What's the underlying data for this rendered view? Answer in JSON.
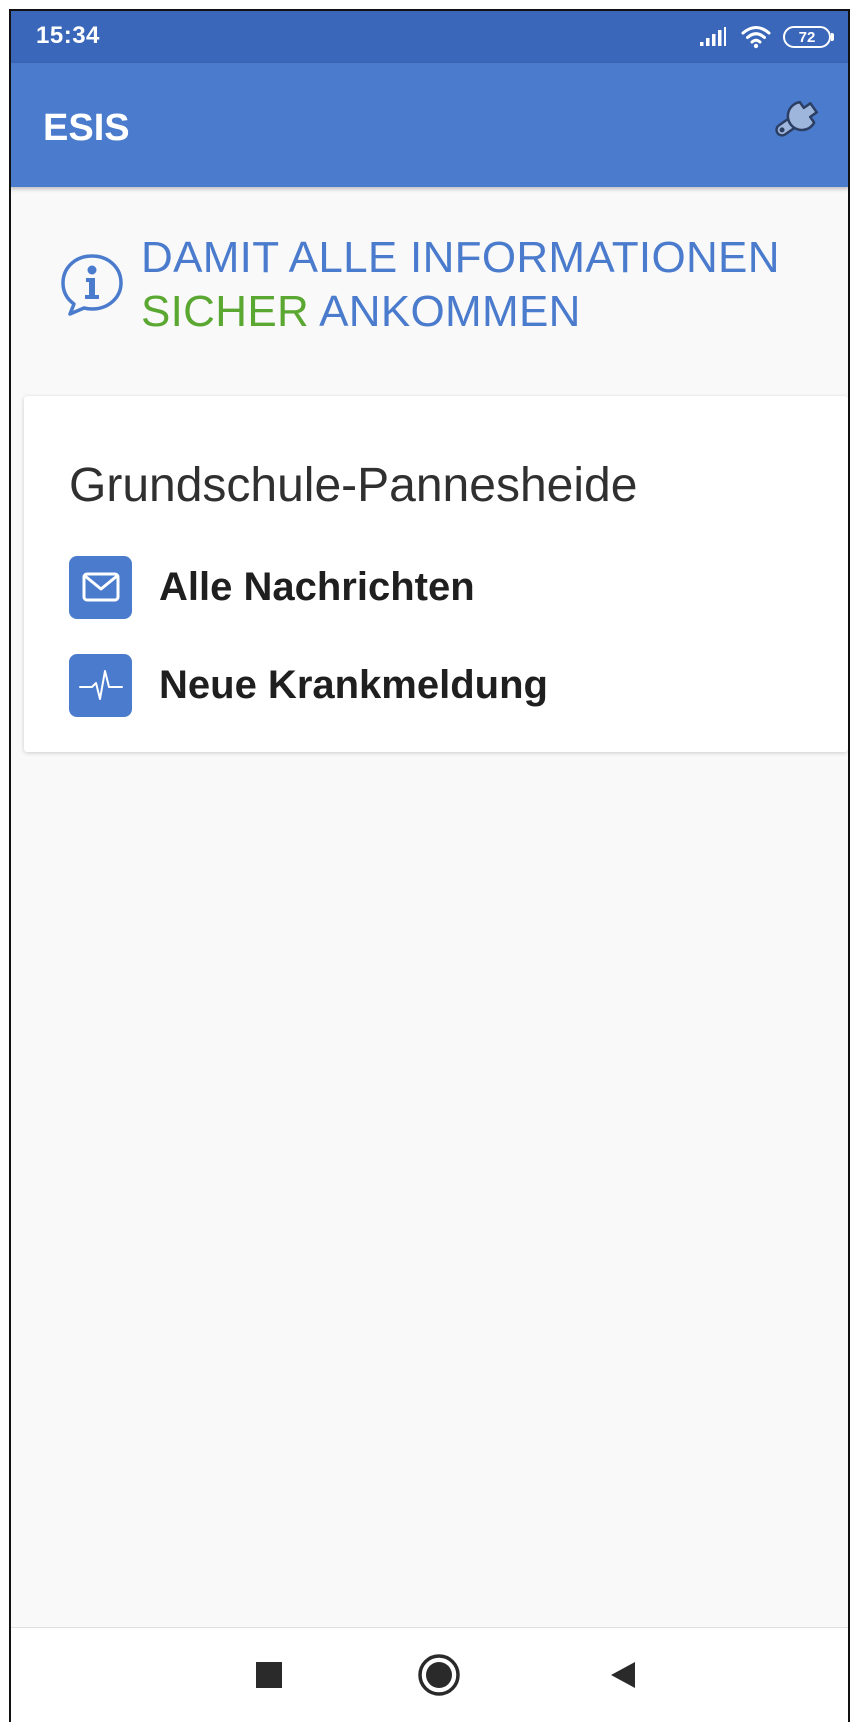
{
  "status_bar": {
    "time": "15:34",
    "battery": "72",
    "icons": [
      "signal-icon",
      "wifi-icon",
      "battery-icon"
    ]
  },
  "app_bar": {
    "title": "ESIS",
    "settings_icon": "wrench-icon"
  },
  "headline": {
    "line1": "DAMIT ALLE INFORMATIONEN",
    "line2_green": "SICHER",
    "line2_blue": " ANKOMMEN",
    "icon": "info-icon"
  },
  "card": {
    "school_name": "Grundschule-Pannesheide",
    "items": [
      {
        "label": "Alle Nachrichten",
        "icon": "envelope-icon"
      },
      {
        "label": "Neue Krankmeldung",
        "icon": "heartbeat-icon"
      }
    ]
  },
  "nav_bar": {
    "buttons": [
      "recents-icon",
      "home-icon",
      "back-icon"
    ]
  },
  "colors": {
    "status_bar": "#3a67b9",
    "app_bar": "#4a7bcd",
    "accent_blue": "#4a7bcd",
    "accent_green": "#5aa832",
    "background": "#f9f9f9"
  }
}
